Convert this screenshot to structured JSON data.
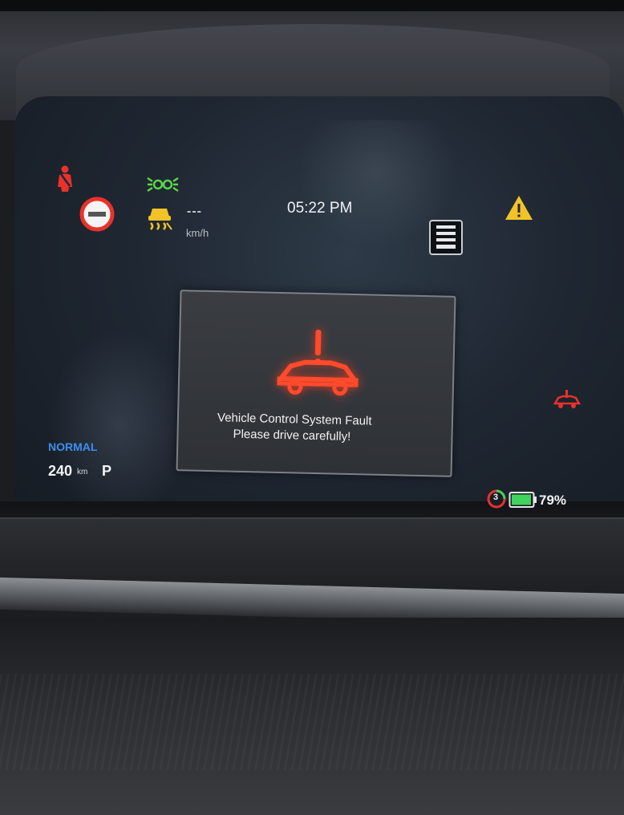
{
  "cluster": {
    "time": "05:22 PM",
    "speed": {
      "value": "---",
      "unit": "km/h"
    },
    "drive_mode": "NORMAL",
    "range": {
      "value": "240",
      "unit": "km"
    },
    "gear": "P",
    "battery_percent": "79%",
    "ready_indicator_count": "3"
  },
  "alert": {
    "title": "Vehicle Control System Fault",
    "message": "Please drive carefully!",
    "icon": "vehicle-fault-warning-icon"
  },
  "indicators": [
    {
      "name": "seatbelt-warning-icon",
      "color": "#e8322b"
    },
    {
      "name": "parking-lights-icon",
      "color": "#5bd64a"
    },
    {
      "name": "no-entry-icon",
      "color": "#e8322b"
    },
    {
      "name": "traction-control-off-icon",
      "color": "#f2c329"
    },
    {
      "name": "lane-assist-icon",
      "color": "#e6e8eb"
    },
    {
      "name": "general-warning-icon",
      "color": "#f2c329"
    },
    {
      "name": "vehicle-fault-small-icon",
      "color": "#e8322b"
    },
    {
      "name": "battery-icon",
      "color": "#3fd45c"
    }
  ]
}
